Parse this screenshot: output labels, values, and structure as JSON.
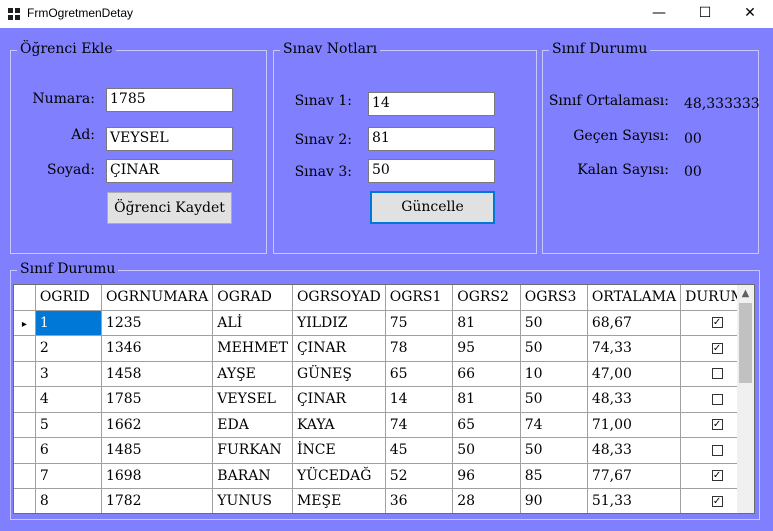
{
  "window": {
    "title": "FrmOgretmenDetay",
    "minimize": "—",
    "maximize": "☐",
    "close": "✕"
  },
  "ogrenci_ekle": {
    "title": "Öğrenci Ekle",
    "numara_label": "Numara:",
    "numara_value": "1785",
    "ad_label": "Ad:",
    "ad_value": "VEYSEL",
    "soyad_label": "Soyad:",
    "soyad_value": "ÇINAR",
    "kaydet_button": "Öğrenci Kaydet"
  },
  "sinav_notlari": {
    "title": "Sınav Notları",
    "sinav1_label": "Sınav 1:",
    "sinav1_value": "14",
    "sinav2_label": "Sınav 2:",
    "sinav2_value": "81",
    "sinav3_label": "Sınav 3:",
    "sinav3_value": "50",
    "guncelle_button": "Güncelle"
  },
  "sinif_durumu_ozet": {
    "title": "Sınıf Durumu",
    "ortalama_label": "Sınıf Ortalaması:",
    "ortalama_value": "48,333333",
    "gecen_label": "Geçen Sayısı:",
    "gecen_value": "00",
    "kalan_label": "Kalan Sayısı:",
    "kalan_value": "00"
  },
  "grid": {
    "title": "Sınıf Durumu",
    "columns": [
      "OGRID",
      "OGRNUMARA",
      "OGRAD",
      "OGRSOYAD",
      "OGRS1",
      "OGRS2",
      "OGRS3",
      "ORTALAMA",
      "DURUM"
    ],
    "rows": [
      {
        "id": "1",
        "numara": "1235",
        "ad": "ALİ",
        "soyad": "YILDIZ",
        "s1": "75",
        "s2": "81",
        "s3": "50",
        "ortalama": "68,67",
        "durum": true,
        "current": true
      },
      {
        "id": "2",
        "numara": "1346",
        "ad": "MEHMET",
        "soyad": "ÇINAR",
        "s1": "78",
        "s2": "95",
        "s3": "50",
        "ortalama": "74,33",
        "durum": true
      },
      {
        "id": "3",
        "numara": "1458",
        "ad": "AYŞE",
        "soyad": "GÜNEŞ",
        "s1": "65",
        "s2": "66",
        "s3": "10",
        "ortalama": "47,00",
        "durum": false
      },
      {
        "id": "4",
        "numara": "1785",
        "ad": "VEYSEL",
        "soyad": "ÇINAR",
        "s1": "14",
        "s2": "81",
        "s3": "50",
        "ortalama": "48,33",
        "durum": false
      },
      {
        "id": "5",
        "numara": "1662",
        "ad": "EDA",
        "soyad": "KAYA",
        "s1": "74",
        "s2": "65",
        "s3": "74",
        "ortalama": "71,00",
        "durum": true
      },
      {
        "id": "6",
        "numara": "1485",
        "ad": "FURKAN",
        "soyad": "İNCE",
        "s1": "45",
        "s2": "50",
        "s3": "50",
        "ortalama": "48,33",
        "durum": false
      },
      {
        "id": "7",
        "numara": "1698",
        "ad": "BARAN",
        "soyad": "YÜCEDAĞ",
        "s1": "52",
        "s2": "96",
        "s3": "85",
        "ortalama": "77,67",
        "durum": true
      },
      {
        "id": "8",
        "numara": "1782",
        "ad": "YUNUS",
        "soyad": "MEŞE",
        "s1": "36",
        "s2": "28",
        "s3": "90",
        "ortalama": "51,33",
        "durum": true
      }
    ]
  },
  "icons": {
    "app": "windows-form-icon",
    "row_pointer": "▸",
    "scroll_up": "▲",
    "scroll_down": "▼",
    "check": "✓"
  },
  "colors": {
    "form_back": "#8080ff",
    "selection": "#0078d7"
  }
}
